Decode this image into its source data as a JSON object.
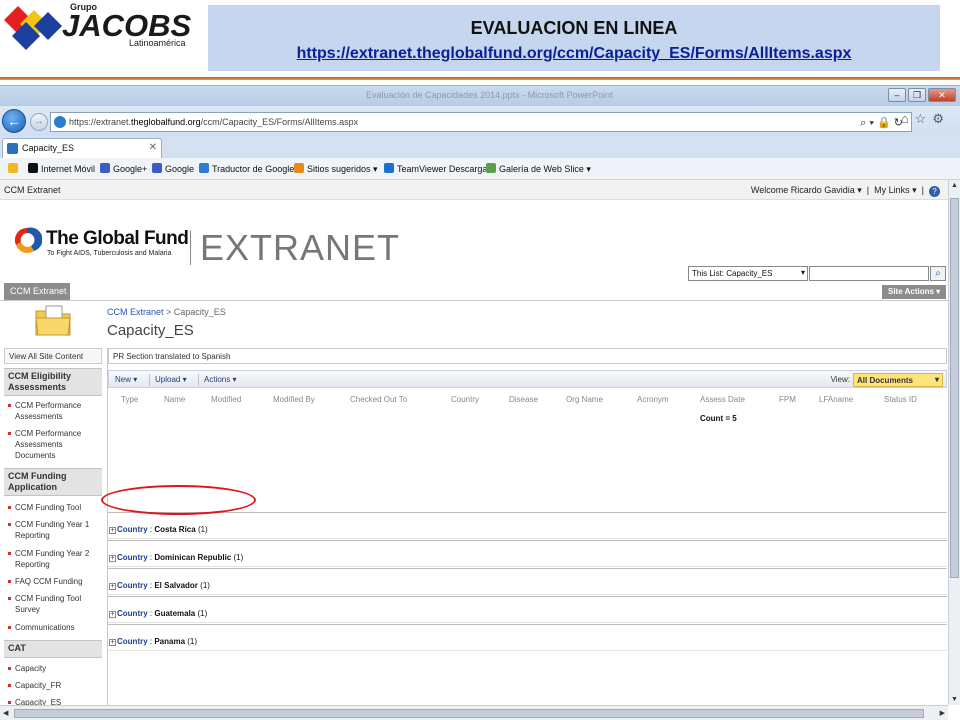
{
  "slide": {
    "logo": {
      "grupo": "Grupo",
      "name": "JACOBS",
      "sub": "Latinoamérica"
    },
    "title": "EVALUACION EN LINEA",
    "url": "https://extranet.theglobalfund.org/ccm/Capacity_ES/Forms/AllItems.aspx"
  },
  "browser": {
    "window_title": "Evaluación de Capacidades 2014.pptx - Microsoft PowerPoint",
    "address_prefix": "https://extranet.",
    "address_host": "theglobalfund.org",
    "address_path": "/ccm/Capacity_ES/Forms/AllItems.aspx",
    "address_tools": "⌕ ▾ 🔒 ↻",
    "tab_label": "Capacity_ES",
    "favorites": [
      {
        "label": "Internet Móvil",
        "color": "#111111"
      },
      {
        "label": "Google+",
        "color": "#3b5cc4"
      },
      {
        "label": "Google",
        "color": "#3b5cc4"
      },
      {
        "label": "Traductor de Google",
        "color": "#2f7bd5"
      },
      {
        "label": "Sitios sugeridos ▾",
        "color": "#e88a1a"
      },
      {
        "label": "TeamViewer Descarga",
        "color": "#1a6fd1"
      },
      {
        "label": "Galería de Web Slice ▾",
        "color": "#5aa04a"
      }
    ]
  },
  "sharepoint": {
    "site_title": "CCM Extranet",
    "welcome": "Welcome Ricardo Gavidia ▾",
    "my_links": "My Links ▾",
    "help": "?",
    "brand": {
      "name": "The Global Fund",
      "tagline": "To Fight AIDS, Tuberculosis and Malaria",
      "extranet": "EXTRANET"
    },
    "search_scope": "This List: Capacity_ES",
    "topnav_tab": "CCM Extranet",
    "site_actions": "Site Actions ▾",
    "breadcrumb": {
      "root": "CCM Extranet",
      "sep": " > ",
      "current": "Capacity_ES"
    },
    "page_title": "Capacity_ES",
    "list_description": "PR Section translated to Spanish",
    "toolbar": {
      "new": "New ▾",
      "upload": "Upload ▾",
      "actions": "Actions ▾",
      "view_label": "View:",
      "view_value": "All Documents"
    },
    "columns": [
      "Type",
      "Name",
      "Modified",
      "Modified By",
      "Checked Out To",
      "Country",
      "Disease",
      "Org Name",
      "Acronym",
      "Assess Date",
      "FPM",
      "LFAname",
      "Status ID"
    ],
    "count": "Count = 5",
    "groups": [
      {
        "field": "Country",
        "value": "Costa Rica",
        "count": "(1)"
      },
      {
        "field": "Country",
        "value": "Dominican Republic",
        "count": "(1)"
      },
      {
        "field": "Country",
        "value": "El Salvador",
        "count": "(1)"
      },
      {
        "field": "Country",
        "value": "Guatemala",
        "count": "(1)"
      },
      {
        "field": "Country",
        "value": "Panama",
        "count": "(1)"
      }
    ],
    "leftnav": {
      "view_all": "View All Site Content",
      "sections": [
        {
          "heading": "CCM Eligibility Assessments",
          "items": [
            "CCM Performance Assessments",
            "CCM Performance Assessments Documents"
          ]
        },
        {
          "heading": "CCM Funding Application",
          "items": [
            "CCM Funding Tool",
            "CCM Funding Year 1 Reporting",
            "CCM Funding Year 2 Reporting",
            "FAQ CCM Funding",
            "CCM Funding Tool Survey",
            "Communications"
          ]
        },
        {
          "heading": "CAT",
          "items": [
            "Capacity",
            "Capacity_FR",
            "Capacity_ES"
          ]
        }
      ]
    }
  }
}
